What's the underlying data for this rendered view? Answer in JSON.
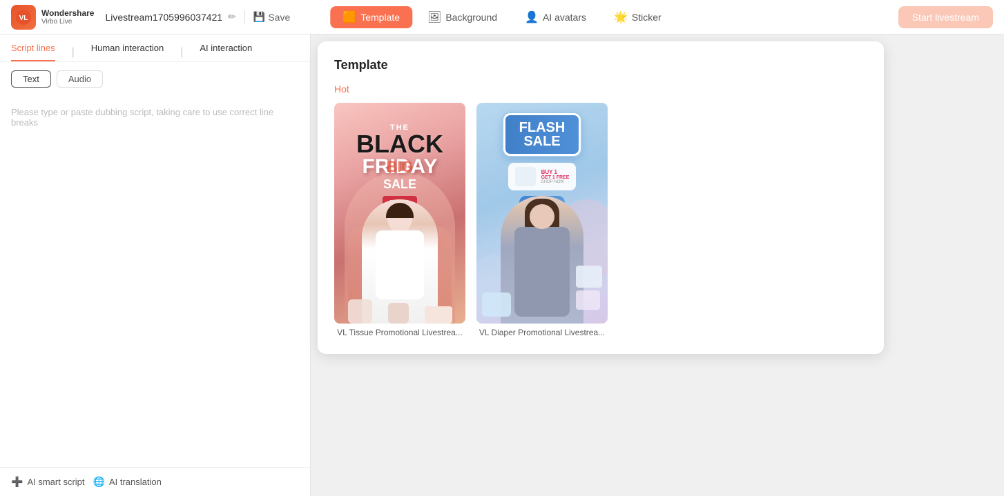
{
  "app": {
    "logo_initials": "VL",
    "logo_name": "Wondershare",
    "logo_sub": "Virbo Live",
    "project_name": "Livestream1705996037421",
    "save_label": "Save",
    "start_livestream_label": "Start livestream"
  },
  "header_nav": {
    "template_label": "Template",
    "background_label": "Background",
    "ai_avatars_label": "AI avatars",
    "sticker_label": "Sticker"
  },
  "sidebar": {
    "tabs": [
      {
        "id": "script-lines",
        "label": "Script lines",
        "active": true
      },
      {
        "id": "human-interaction",
        "label": "Human interaction",
        "active": false
      },
      {
        "id": "ai-interaction",
        "label": "AI interaction",
        "active": false
      }
    ],
    "script_tabs": [
      {
        "id": "text",
        "label": "Text",
        "active": true
      },
      {
        "id": "audio",
        "label": "Audio",
        "active": false
      }
    ],
    "placeholder": "Please type or paste dubbing script, taking care to use correct line breaks",
    "bottom_buttons": [
      {
        "id": "ai-smart-script",
        "label": "AI smart script"
      },
      {
        "id": "ai-translation",
        "label": "AI translation"
      }
    ]
  },
  "template_panel": {
    "title": "Template",
    "section_label": "Hot",
    "templates": [
      {
        "id": "tissue-promo",
        "label": "VL Tissue Promotional Livestrea...",
        "type": "black-friday"
      },
      {
        "id": "diaper-promo",
        "label": "VL Diaper Promotional Livestrea...",
        "type": "flash-sale"
      }
    ]
  },
  "colors": {
    "accent": "#f97150",
    "accent_light": "#fbc8b8",
    "active_bg": "#f97150"
  }
}
